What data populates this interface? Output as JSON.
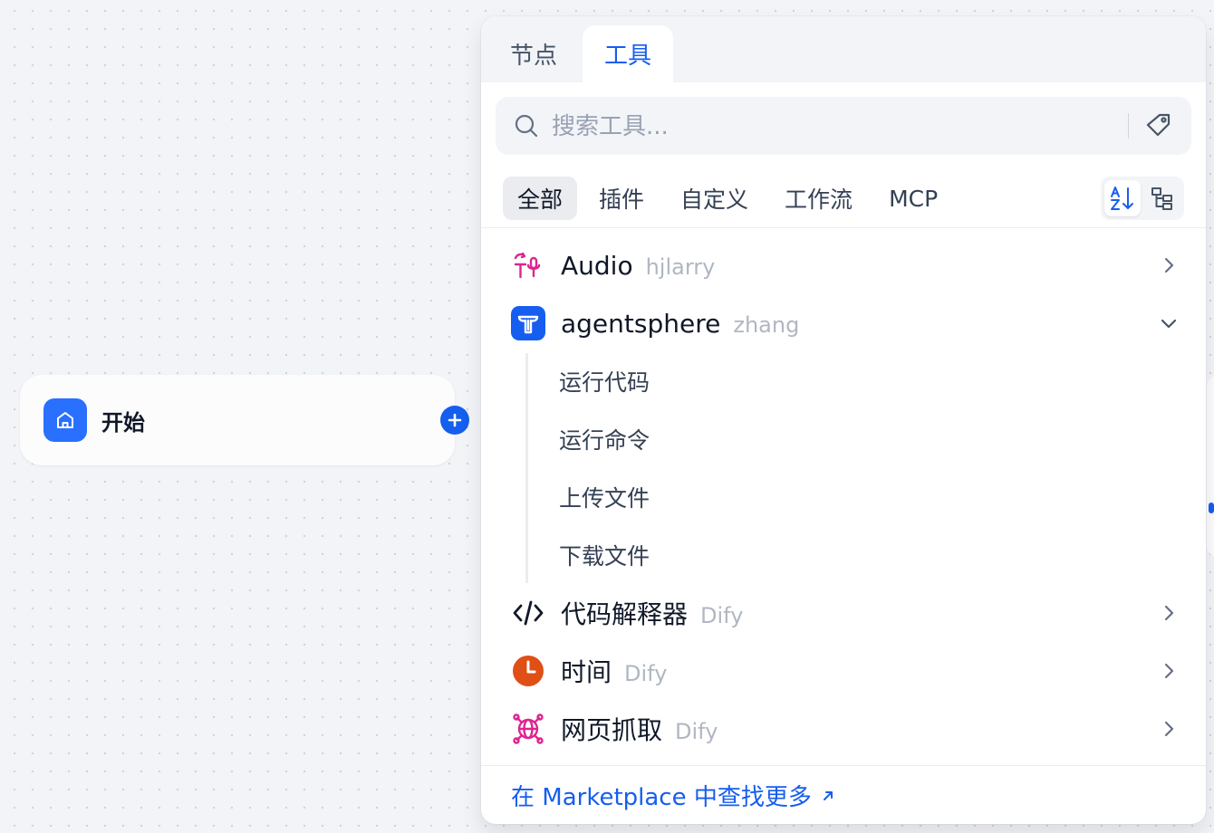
{
  "start_node": {
    "title": "开始"
  },
  "panel": {
    "tabs": [
      {
        "label": "节点"
      },
      {
        "label": "工具"
      }
    ],
    "search": {
      "placeholder": "搜索工具..."
    },
    "filters": [
      {
        "label": "全部"
      },
      {
        "label": "插件"
      },
      {
        "label": "自定义"
      },
      {
        "label": "工作流"
      },
      {
        "label": "MCP"
      }
    ],
    "tools": [
      {
        "name": "Audio",
        "author": "hjlarry",
        "icon": "audio-plugin-icon"
      },
      {
        "name": "agentsphere",
        "author": "zhang",
        "icon": "agentsphere-icon",
        "expanded": true,
        "actions": [
          {
            "label": "运行代码"
          },
          {
            "label": "运行命令"
          },
          {
            "label": "上传文件"
          },
          {
            "label": "下载文件"
          }
        ]
      },
      {
        "name": "代码解释器",
        "author": "Dify",
        "icon": "code-icon"
      },
      {
        "name": "时间",
        "author": "Dify",
        "icon": "clock-icon"
      },
      {
        "name": "网页抓取",
        "author": "Dify",
        "icon": "web-scraper-icon"
      }
    ],
    "footer": {
      "link": "在 Marketplace 中查找更多"
    }
  },
  "colors": {
    "accent": "#155eef",
    "start_icon_bg": "#2970ff",
    "clock": "#e04f16",
    "pink": "#dd2590"
  }
}
